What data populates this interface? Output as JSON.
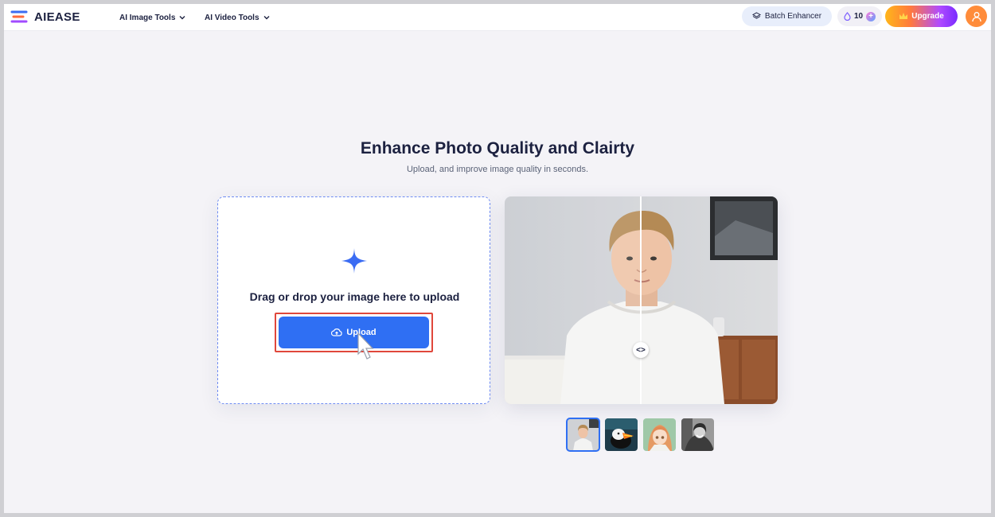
{
  "header": {
    "logo_text": "AIEASE",
    "nav": [
      {
        "label": "AI Image Tools"
      },
      {
        "label": "AI Video Tools"
      }
    ],
    "batch_label": "Batch Enhancer",
    "credits": "10",
    "upgrade_label": "Upgrade"
  },
  "hero": {
    "title": "Enhance Photo Quality and Clairty",
    "subtitle": "Upload, and improve image quality in seconds."
  },
  "upload": {
    "drag_text": "Drag or drop your image here to upload",
    "button_label": "Upload"
  },
  "preview": {
    "compare_icon": "<>",
    "thumbnails": [
      "portrait-young-man",
      "puffin-bird",
      "anime-girl",
      "bw-woman-portrait"
    ],
    "active_thumbnail": 0
  },
  "colors": {
    "accent": "#2f6ff3",
    "highlight": "#e0473b",
    "title": "#1c2140"
  }
}
